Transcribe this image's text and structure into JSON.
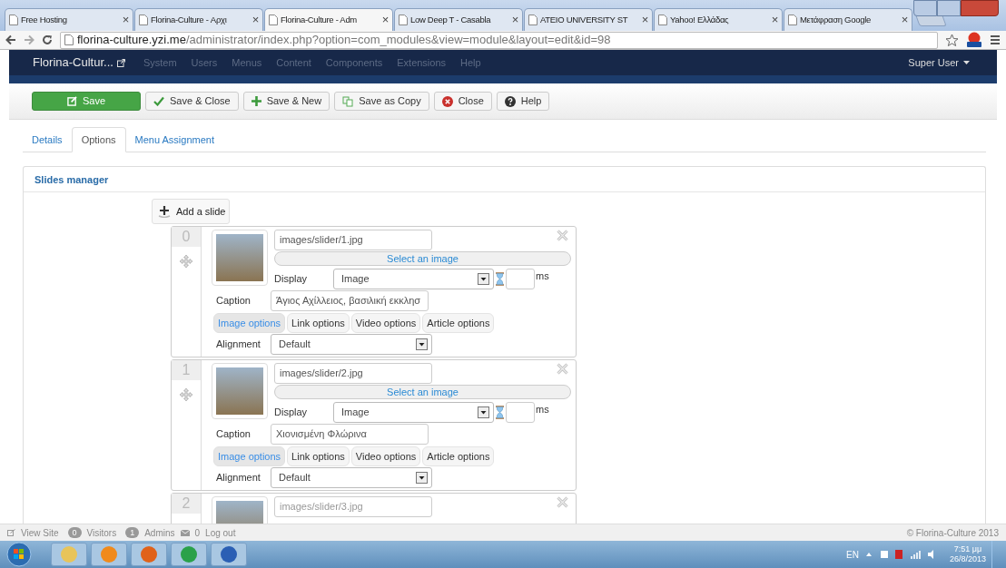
{
  "browser": {
    "tabs": [
      {
        "title": "Free Hosting",
        "selected": false
      },
      {
        "title": "Florina-Culture - Αρχι",
        "selected": false
      },
      {
        "title": "Florina-Culture - Adm",
        "selected": true
      },
      {
        "title": "Low Deep T - Casabla",
        "selected": false
      },
      {
        "title": "ATEIO UNIVERSITY ST",
        "selected": false
      },
      {
        "title": "Yahoo! Ελλάδας",
        "selected": false
      },
      {
        "title": "Μετάφραση Google",
        "selected": false
      }
    ],
    "close_glyph": "×",
    "url_host": "florina-culture.yzi.me",
    "url_path": "/administrator/index.php?option=com_modules&view=module&layout=edit&id=98"
  },
  "navbar": {
    "site": "Florina-Cultur...",
    "menu": [
      "System",
      "Users",
      "Menus",
      "Content",
      "Components",
      "Extensions",
      "Help"
    ],
    "user": "Super User"
  },
  "toolbar": [
    {
      "label": "Save",
      "kind": "primary"
    },
    {
      "label": "Save & Close",
      "kind": "check"
    },
    {
      "label": "Save & New",
      "kind": "plus"
    },
    {
      "label": "Save as Copy",
      "kind": "copy"
    },
    {
      "label": "Close",
      "kind": "close"
    },
    {
      "label": "Help",
      "kind": "help"
    }
  ],
  "tabs": [
    {
      "label": "Details",
      "selected": false
    },
    {
      "label": "Options",
      "selected": true
    },
    {
      "label": "Menu Assignment",
      "selected": false
    }
  ],
  "panel": {
    "title": "Slides manager",
    "add_label": "Add a slide",
    "slides": [
      {
        "number": "0",
        "path": "images/slider/1.jpg",
        "select": "Select an image",
        "display_label": "Display",
        "display": "Image",
        "ms": "ms",
        "caption_label": "Caption",
        "caption": "Άγιος Αχίλλειος, βασιλική εκκλησ",
        "options": [
          {
            "label": "Image options",
            "selected": true
          },
          {
            "label": "Link options",
            "selected": false
          },
          {
            "label": "Video options",
            "selected": false
          },
          {
            "label": "Article options",
            "selected": false
          }
        ],
        "alignment_label": "Alignment",
        "alignment": "Default"
      },
      {
        "number": "1",
        "path": "images/slider/2.jpg",
        "select": "Select an image",
        "display_label": "Display",
        "display": "Image",
        "ms": "ms",
        "caption_label": "Caption",
        "caption": "Χιονισμένη Φλώρινα",
        "options": [
          {
            "label": "Image options",
            "selected": true
          },
          {
            "label": "Link options",
            "selected": false
          },
          {
            "label": "Video options",
            "selected": false
          },
          {
            "label": "Article options",
            "selected": false
          }
        ],
        "alignment_label": "Alignment",
        "alignment": "Default"
      },
      {
        "number": "2",
        "path": "images/slider/3.jpg"
      }
    ]
  },
  "footer": {
    "view_site": "View Site",
    "visitors_count": "0",
    "visitors": "Visitors",
    "admins_count": "1",
    "admins": "Admins",
    "messages_count": "0",
    "logout": "Log out",
    "copyright": "© Florina-Culture 2013"
  },
  "taskbar": {
    "lang": "EN",
    "time": "7:51 μμ",
    "date": "26/8/2013"
  }
}
